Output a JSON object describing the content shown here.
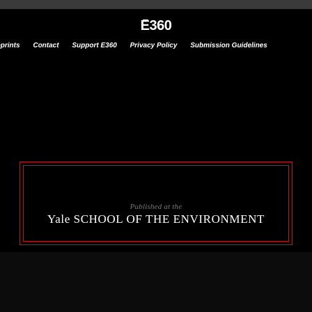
{
  "header": {
    "logo_text": "E360"
  },
  "nav": {
    "items": [
      "Reprints",
      "Contact",
      "Support E360",
      "Privacy Policy",
      "Submission Guidelines"
    ]
  },
  "banner": {
    "published_label": "Published at the",
    "org_name": "Yale SCHOOL OF THE ENVIRONMENT"
  },
  "colors": {
    "background": "#000000",
    "banner_border": "#c01818",
    "text": "#ffffff"
  }
}
